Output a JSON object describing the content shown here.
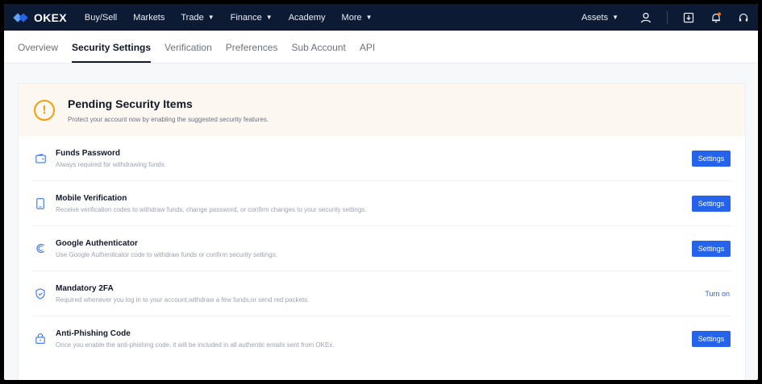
{
  "brand": {
    "name": "OKEX"
  },
  "topnav": {
    "items": [
      {
        "label": "Buy/Sell",
        "caret": false
      },
      {
        "label": "Markets",
        "caret": false
      },
      {
        "label": "Trade",
        "caret": true
      },
      {
        "label": "Finance",
        "caret": true
      },
      {
        "label": "Academy",
        "caret": false
      },
      {
        "label": "More",
        "caret": true
      }
    ],
    "assets_label": "Assets"
  },
  "subtabs": {
    "items": [
      "Overview",
      "Security Settings",
      "Verification",
      "Preferences",
      "Sub Account",
      "API"
    ],
    "active": "Security Settings"
  },
  "pending": {
    "title": "Pending Security Items",
    "description": "Protect your account now by enabling the suggested security features."
  },
  "security_items": [
    {
      "title": "Funds Password",
      "description": "Always required for withdrawing funds.",
      "action": "Settings",
      "action_type": "button",
      "icon": "wallet-icon"
    },
    {
      "title": "Mobile Verification",
      "description": "Receive verification codes to withdraw funds, change password, or confirm changes to your security settings.",
      "action": "Settings",
      "action_type": "button",
      "icon": "phone-icon"
    },
    {
      "title": "Google Authenticator",
      "description": "Use Google Authenticator code to withdraw funds or confirm security settings.",
      "action": "Settings",
      "action_type": "button",
      "icon": "google-icon"
    },
    {
      "title": "Mandatory 2FA",
      "description": "Required whenever you log in to your account,withdraw a few funds,or send red packets.",
      "action": "Turn on",
      "action_type": "link",
      "icon": "shield-icon"
    },
    {
      "title": "Anti-Phishing Code",
      "description": "Once you enable the anti-phishing code, it will be included in all authentic emails sent from OKEx.",
      "action": "Settings",
      "action_type": "button",
      "icon": "lock-icon"
    }
  ],
  "colors": {
    "nav_bg": "#0d1a33",
    "accent": "#2563eb",
    "warning": "#f59e0b",
    "pending_bg": "#fdf7f1"
  }
}
